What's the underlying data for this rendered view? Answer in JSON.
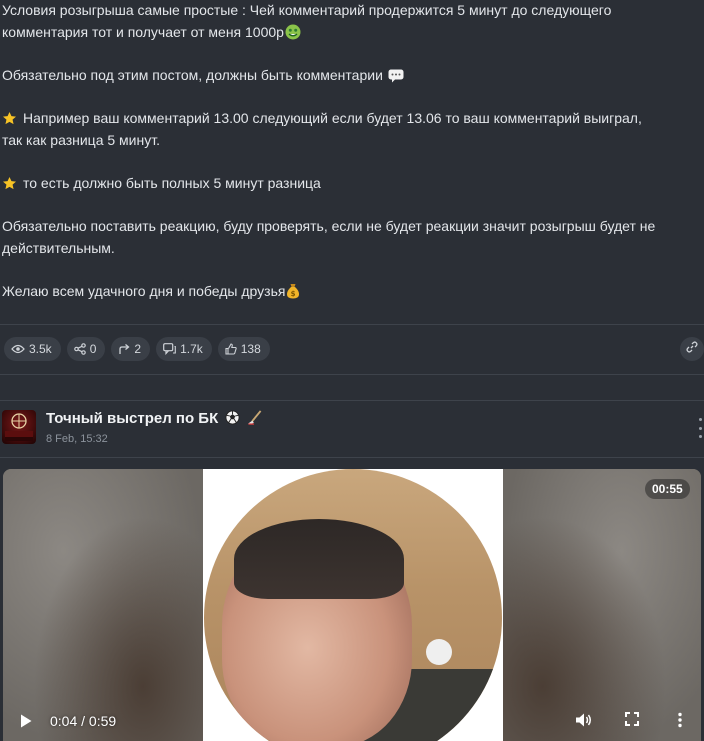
{
  "post": {
    "lines": [
      "Условия розыгрыша самые простые : Чей комментарий продержится 5 минут до следующего",
      "комментария тот и получает от меня 1000р",
      "Обязательно под этим постом, должны быть комментарии",
      "Например ваш комментарий 13.00 следующий если будет 13.06 то ваш комментарий выиграл,",
      "так как разница 5 минут.",
      "то есть должно быть полных 5 минут разница",
      "Обязательно поставить реакцию, буду проверять, если не будет реакции значит розыгрыш будет не",
      "действительным.",
      "Желаю всем удачного дня и победы друзья"
    ],
    "emoji_icons": [
      "money-mouth-face-icon",
      "speech-bubble-icon",
      "star-icon",
      "star-icon",
      "money-bag-icon"
    ],
    "stats": {
      "views": "3.5k",
      "shares": "0",
      "forwards": "2",
      "comments": "1.7k",
      "likes": "138"
    }
  },
  "next_post": {
    "channel_name": "Точный выстрел по БК",
    "name_icons": [
      "soccer-ball-icon",
      "hockey-stick-icon"
    ],
    "date": "8 Feb, 15:32",
    "avatar_icon": "channel-avatar",
    "video": {
      "duration_badge": "00:55",
      "time_display": "0:04 / 0:59"
    }
  },
  "colors": {
    "background": "#2b2f36",
    "chip": "#3a3f47",
    "text": "#e3e6ea",
    "muted": "#8c939c"
  }
}
